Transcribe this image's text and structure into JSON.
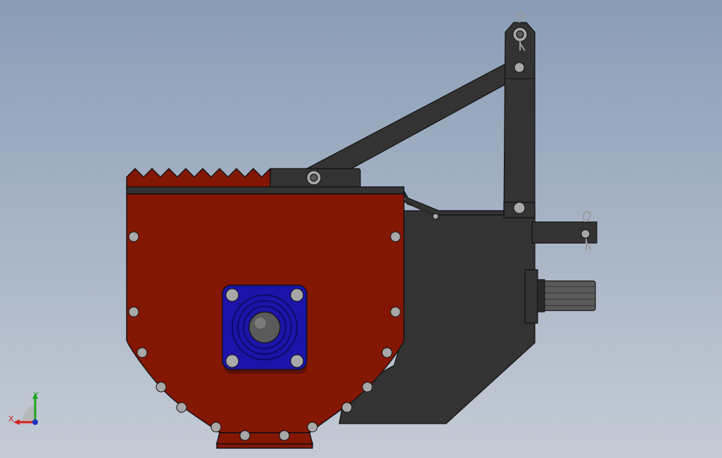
{
  "viewport": {
    "background_top": "#8a9db6",
    "background_bottom": "#c4cbd5"
  },
  "model": {
    "body_color": "#841704",
    "frame_color": "#333333",
    "flange_color": "#1c14a8",
    "bolt_color": "#a8a8a8",
    "shaft_color": "#5a5a5a",
    "outline_color": "#111111"
  },
  "triad": {
    "x_label": "X",
    "y_label": "Y",
    "x_color": "#d42020",
    "y_color": "#1aa51a",
    "z_color": "#2030c0"
  }
}
